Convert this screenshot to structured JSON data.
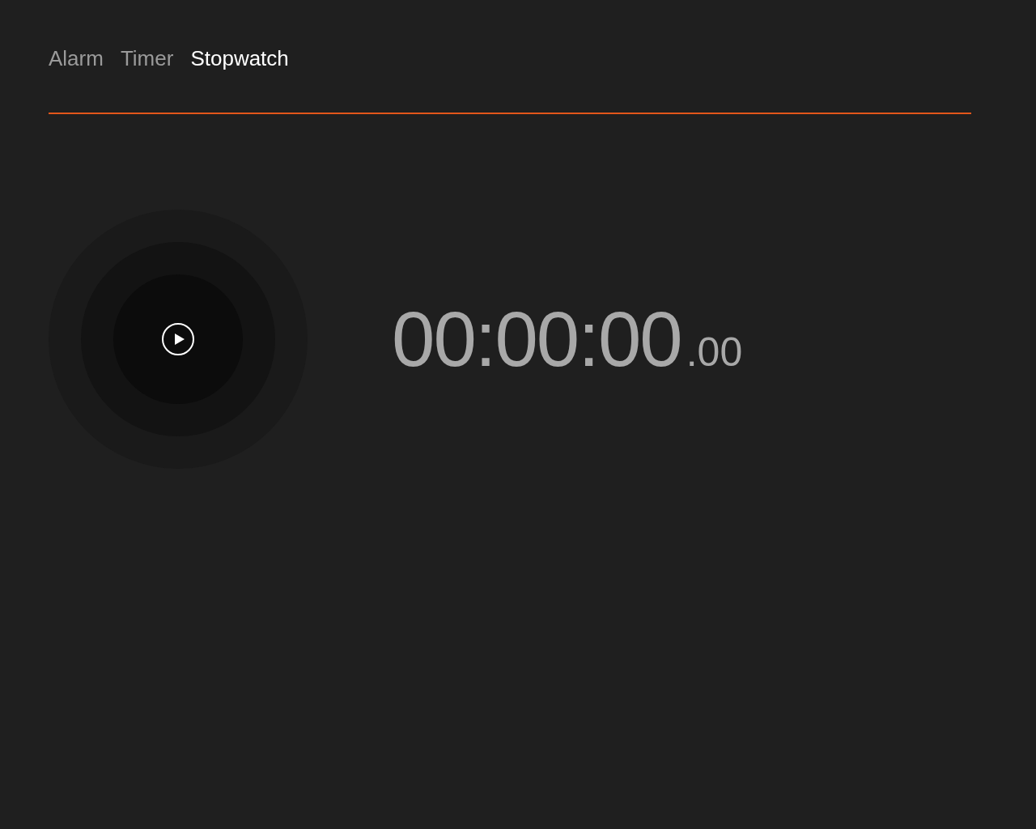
{
  "tabs": [
    {
      "label": "Alarm",
      "selected": false
    },
    {
      "label": "Timer",
      "selected": false
    },
    {
      "label": "Stopwatch",
      "selected": true
    }
  ],
  "stopwatch": {
    "running": false,
    "time": "00:00:00",
    "fraction": ".00"
  }
}
